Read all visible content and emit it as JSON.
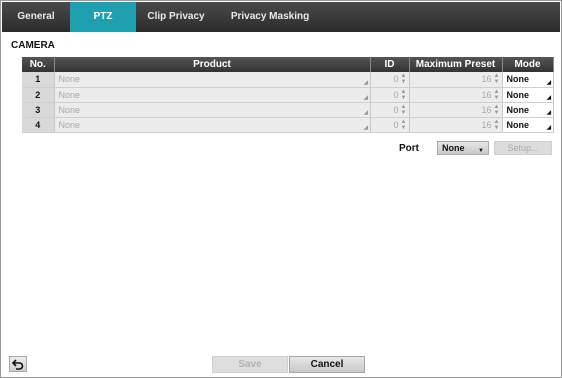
{
  "tabs": [
    {
      "label": "General"
    },
    {
      "label": "PTZ"
    },
    {
      "label": "Clip Privacy"
    },
    {
      "label": "Privacy Masking"
    }
  ],
  "section_title": "CAMERA",
  "table": {
    "headers": [
      "No.",
      "Product",
      "ID",
      "Maximum Preset",
      "Mode"
    ],
    "rows": [
      {
        "no": "1",
        "product": "None",
        "id": "0",
        "max_preset": "16",
        "mode": "None"
      },
      {
        "no": "2",
        "product": "None",
        "id": "0",
        "max_preset": "16",
        "mode": "None"
      },
      {
        "no": "3",
        "product": "None",
        "id": "0",
        "max_preset": "16",
        "mode": "None"
      },
      {
        "no": "4",
        "product": "None",
        "id": "0",
        "max_preset": "16",
        "mode": "None"
      }
    ]
  },
  "port": {
    "label": "Port",
    "value": "None",
    "setup_label": "Setup..."
  },
  "footer": {
    "save_label": "Save",
    "cancel_label": "Cancel"
  },
  "colors": {
    "active_tab": "#1fa0b0",
    "header_bg": "#3a3a3a"
  }
}
